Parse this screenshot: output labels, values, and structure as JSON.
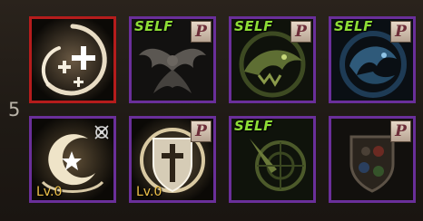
{
  "row_number": "5",
  "badges": {
    "self": "SELF",
    "passive": "P"
  },
  "colors": {
    "slot_border": "#6a2f9a",
    "selected_border": "#b51c1c",
    "self_text": "#8ddd36",
    "level_text": "#f0c34a"
  },
  "slots": [
    {
      "icon": "holy-crosses-skill-icon",
      "selected": true,
      "self": false,
      "passive": false
    },
    {
      "icon": "wings-skill-icon",
      "self": true,
      "passive": true
    },
    {
      "icon": "green-beast-skill-icon",
      "self": true,
      "passive": true
    },
    {
      "icon": "blue-dragon-skill-icon",
      "self": true,
      "passive": true
    },
    {
      "icon": "moon-star-skill-icon",
      "level": "Lv.0",
      "ignore_marker": true
    },
    {
      "icon": "cross-shield-skill-icon",
      "level": "Lv.0",
      "passive": true
    },
    {
      "icon": "compass-skill-icon",
      "self": true,
      "passive": false
    },
    {
      "icon": "elements-shield-skill-icon",
      "self": false,
      "passive": true
    }
  ]
}
